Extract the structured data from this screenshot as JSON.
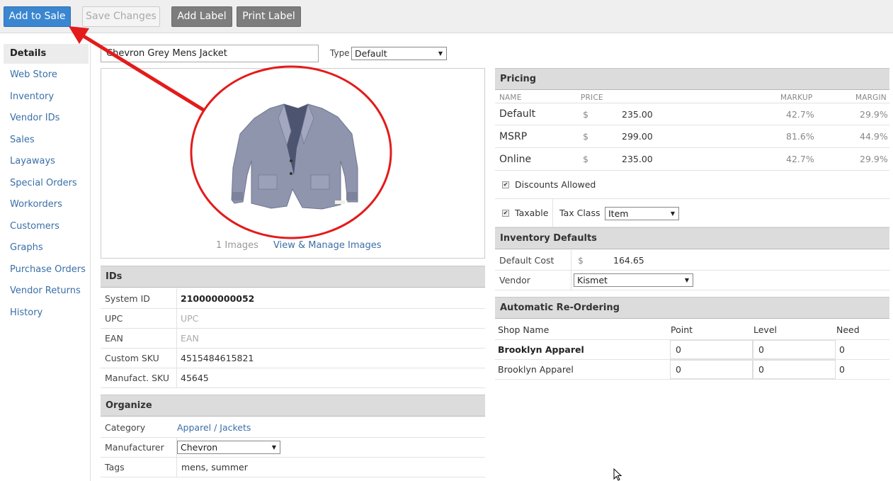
{
  "toolbar": {
    "add_to_sale": "Add to Sale",
    "save_changes": "Save Changes",
    "add_label": "Add Label",
    "print_label": "Print Label"
  },
  "sidebar": {
    "items": [
      {
        "label": "Details"
      },
      {
        "label": "Web Store"
      },
      {
        "label": "Inventory"
      },
      {
        "label": "Vendor IDs"
      },
      {
        "label": "Sales"
      },
      {
        "label": "Layaways"
      },
      {
        "label": "Special Orders"
      },
      {
        "label": "Workorders"
      },
      {
        "label": "Customers"
      },
      {
        "label": "Graphs"
      },
      {
        "label": "Purchase Orders"
      },
      {
        "label": "Vendor Returns"
      },
      {
        "label": "History"
      }
    ]
  },
  "item": {
    "name": "Chevron Grey Mens Jacket",
    "type_label": "Type",
    "type_value": "Default"
  },
  "images": {
    "count": "1 Images",
    "manage_link": "View & Manage Images"
  },
  "ids": {
    "title": "IDs",
    "rows": [
      {
        "label": "System ID",
        "value": "210000000052"
      },
      {
        "label": "UPC",
        "value": "UPC"
      },
      {
        "label": "EAN",
        "value": "EAN"
      },
      {
        "label": "Custom SKU",
        "value": "4515484615821"
      },
      {
        "label": "Manufact. SKU",
        "value": "45645"
      }
    ]
  },
  "organize": {
    "title": "Organize",
    "category_label": "Category",
    "category_value": "Apparel / Jackets",
    "manufacturer_label": "Manufacturer",
    "manufacturer_value": "Chevron",
    "tags_label": "Tags",
    "tags_value": "mens, summer"
  },
  "pricing": {
    "title": "Pricing",
    "col_name": "NAME",
    "col_price": "PRICE",
    "col_markup": "MARKUP",
    "col_margin": "MARGIN",
    "currency": "$",
    "rows": [
      {
        "name": "Default",
        "price": "235.00",
        "markup": "42.7%",
        "margin": "29.9%"
      },
      {
        "name": "MSRP",
        "price": "299.00",
        "markup": "81.6%",
        "margin": "44.9%"
      },
      {
        "name": "Online",
        "price": "235.00",
        "markup": "42.7%",
        "margin": "29.9%"
      }
    ],
    "discounts_label": "Discounts Allowed",
    "taxable_label": "Taxable",
    "tax_class_label": "Tax Class",
    "tax_class_value": "Item"
  },
  "inventory_defaults": {
    "title": "Inventory Defaults",
    "default_cost_label": "Default Cost",
    "currency": "$",
    "default_cost_value": "164.65",
    "vendor_label": "Vendor",
    "vendor_value": "Kismet"
  },
  "reorder": {
    "title": "Automatic Re-Ordering",
    "col_shop": "Shop Name",
    "col_point": "Point",
    "col_level": "Level",
    "col_need": "Need",
    "rows": [
      {
        "shop": "Brooklyn Apparel",
        "point": "0",
        "level": "0",
        "need": "0"
      },
      {
        "shop": "Brooklyn Apparel",
        "point": "0",
        "level": "0",
        "need": "0"
      }
    ]
  },
  "colors": {
    "primary_button": "#3b86d1",
    "gray_button": "#7d7d7d",
    "link": "#3a6fa8",
    "annotation_red": "#e31b1b"
  }
}
